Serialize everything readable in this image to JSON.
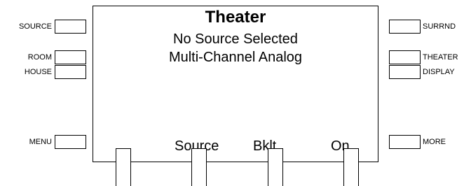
{
  "left_buttons": [
    {
      "label": "SOURCE"
    },
    {
      "label": "ROOM"
    },
    {
      "label": "HOUSE"
    },
    {
      "label": "MENU"
    }
  ],
  "right_buttons": [
    {
      "label": "SURRND"
    },
    {
      "label": "THEATER"
    },
    {
      "label": "DISPLAY"
    },
    {
      "label": "MORE"
    }
  ],
  "display": {
    "title": "Theater",
    "line1": "No Source Selected",
    "line2": "Multi-Channel Analog",
    "softkeys": [
      "Source",
      "Bklt",
      "On",
      ""
    ]
  }
}
